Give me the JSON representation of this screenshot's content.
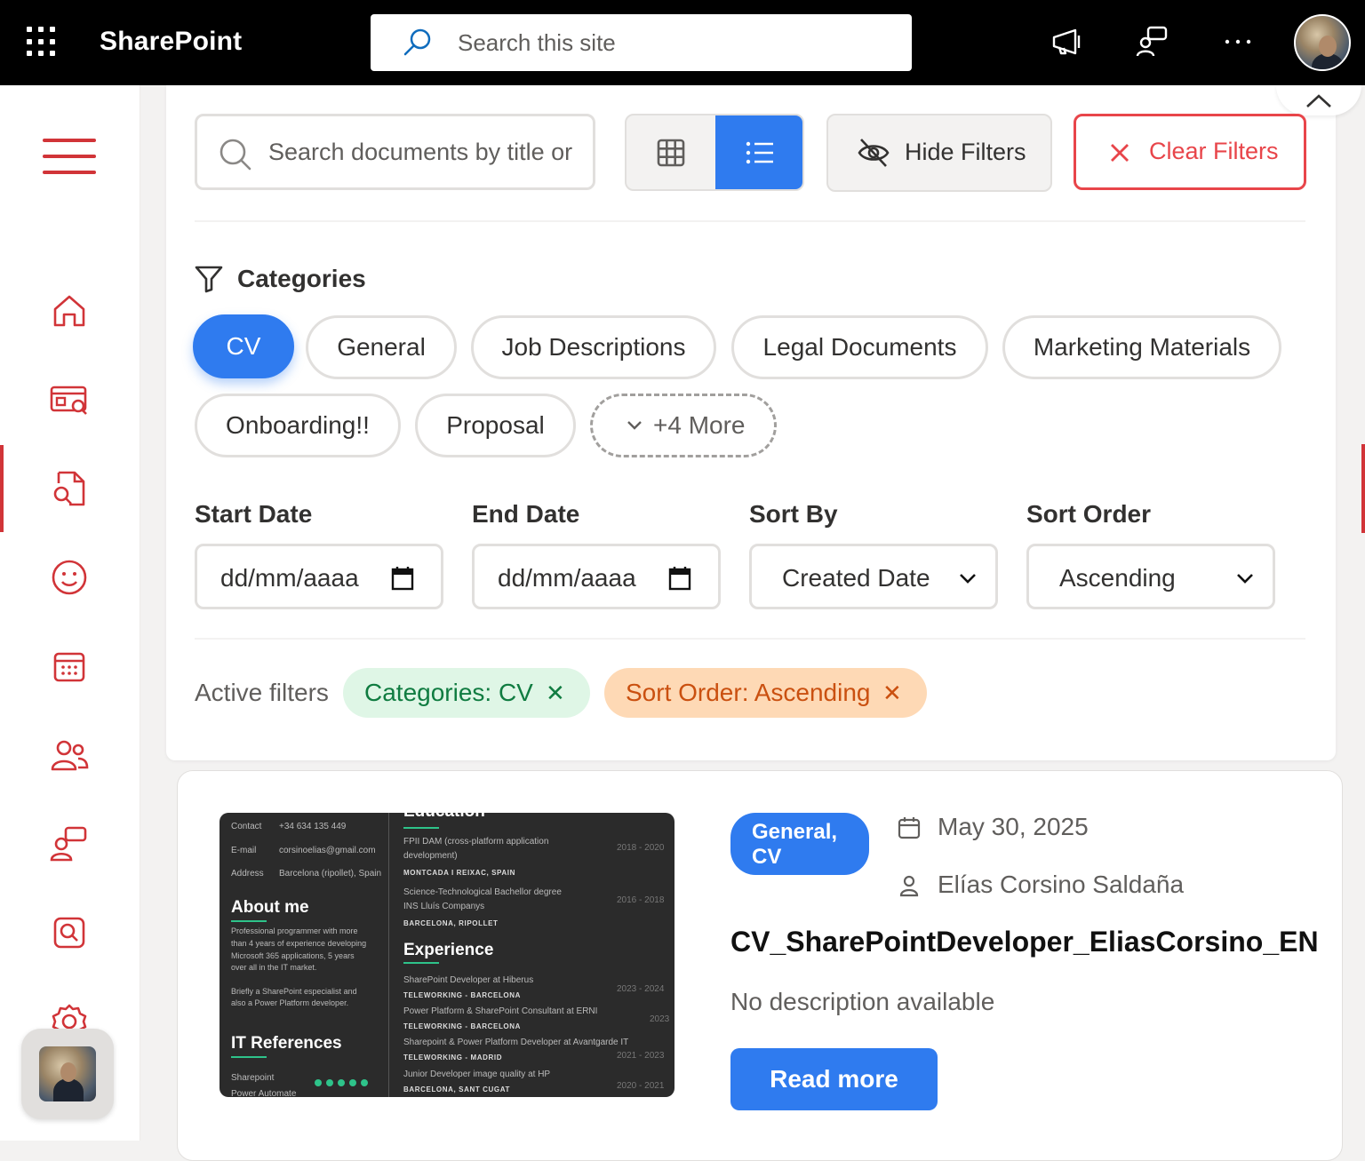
{
  "topbar": {
    "app_name": "SharePoint",
    "search_placeholder": "Search this site",
    "icons": [
      "waffle-icon",
      "megaphone-icon",
      "chat-icon",
      "more-icon",
      "avatar"
    ]
  },
  "leftnav": {
    "icons": [
      "menu-icon",
      "home-icon",
      "news-icon",
      "document-search-icon",
      "smiley-icon",
      "calendar-icon",
      "people-icon",
      "chat-icon",
      "search-icon",
      "settings-icon"
    ],
    "active_item": "document-search-icon"
  },
  "toolbar": {
    "search_placeholder": "Search documents by title or",
    "view_modes": [
      "grid",
      "list"
    ],
    "active_view": "list",
    "hide_filters_label": "Hide Filters",
    "clear_filters_label": "Clear Filters"
  },
  "categories": {
    "heading": "Categories",
    "chips": [
      "CV",
      "General",
      "Job Descriptions",
      "Legal Documents",
      "Marketing Materials",
      "Onboarding!!",
      "Proposal"
    ],
    "active": "CV",
    "more_label": "+4 More"
  },
  "filters": {
    "start_date": {
      "label": "Start Date",
      "value": "dd/mm/aaaa"
    },
    "end_date": {
      "label": "End Date",
      "value": "dd/mm/aaaa"
    },
    "sort_by": {
      "label": "Sort By",
      "value": "Created Date"
    },
    "sort_order": {
      "label": "Sort Order",
      "value": "Ascending"
    }
  },
  "active_filters": {
    "label": "Active filters",
    "tags": [
      "Categories: CV",
      "Sort Order: Ascending"
    ],
    "remove_symbol": "✕"
  },
  "document": {
    "badge": "General, CV",
    "date": "May 30, 2025",
    "author": "Elías Corsino Saldaña",
    "title": "CV_SharePointDeveloper_EliasCorsino_EN",
    "description": "No description available",
    "read_more_label": "Read more",
    "thumbnail": {
      "contact_rows": [
        {
          "k": "Contact",
          "v": "+34 634 135 449"
        },
        {
          "k": "E-mail",
          "v": "corsinoelias@gmail.com"
        },
        {
          "k": "Address",
          "v": "Barcelona (ripollet), Spain"
        }
      ],
      "about_heading": "About me",
      "about_lines": [
        "Professional programmer with more",
        "than 4 years of experience developing",
        "Microsoft 365 applications, 5 years",
        "over all in the IT market.",
        "",
        "Briefly a SharePoint especialist and",
        "also a Power Platform developer."
      ],
      "refs_heading": "IT References",
      "refs_items": [
        "Sharepoint",
        "Power Automate"
      ],
      "education_heading": "Education",
      "education": [
        {
          "title": "FPII DAM (cross-platform application",
          "title2": "development)",
          "place": "MONTCADA I REIXAC, SPAIN",
          "years": "2018 - 2020"
        },
        {
          "title": "Science-Technological Bachellor degree",
          "title2": "INS Lluís Companys",
          "place": "BARCELONA, RIPOLLET",
          "years": "2016 - 2018"
        }
      ],
      "experience_heading": "Experience",
      "experience": [
        {
          "title": "SharePoint Developer at Hiberus",
          "place": "TELEWORKING - BARCELONA",
          "years": "2023 - 2024"
        },
        {
          "title": "Power Platform & SharePoint Consultant at ERNI",
          "place": "TELEWORKING - BARCELONA",
          "years": "2023"
        },
        {
          "title": "Sharepoint & Power Platform Developer at Avantgarde IT",
          "place": "TELEWORKING - MADRID",
          "years": "2021 - 2023"
        },
        {
          "title": "Junior Developer image quality at HP",
          "place": "BARCELONA, SANT CUGAT",
          "years": "2020 - 2021"
        }
      ]
    }
  }
}
